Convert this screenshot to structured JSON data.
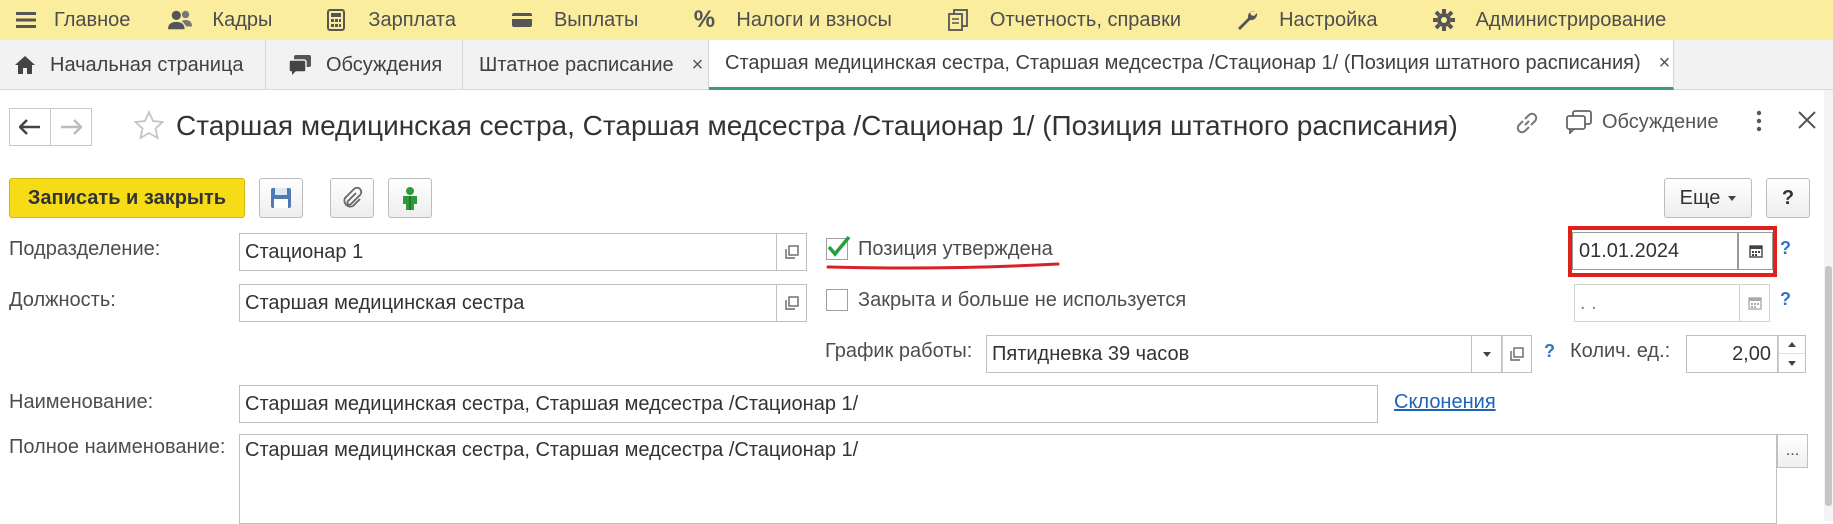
{
  "topbar": {
    "items": [
      {
        "label": "Главное",
        "icon": "home-icon"
      },
      {
        "label": "Кадры",
        "icon": "people-icon"
      },
      {
        "label": "Зарплата",
        "icon": "calculator-icon"
      },
      {
        "label": "Выплаты",
        "icon": "wallet-icon"
      },
      {
        "label": "Налоги и взносы",
        "icon": "percent-icon"
      },
      {
        "label": "Отчетность, справки",
        "icon": "documents-icon"
      },
      {
        "label": "Настройка",
        "icon": "wrench-icon"
      },
      {
        "label": "Администрирование",
        "icon": "gear-icon"
      }
    ]
  },
  "tabs": [
    {
      "label": "Начальная страница",
      "icon": "home-icon"
    },
    {
      "label": "Обсуждения",
      "icon": "chat-icon"
    },
    {
      "label": "Штатное расписание",
      "close": "×"
    },
    {
      "label": "Старшая медицинская сестра, Старшая медсестра /Стационар 1/ (Позиция штатного расписания)",
      "close": "×"
    }
  ],
  "header": {
    "title": "Старшая медицинская сестра, Старшая медсестра /Стационар 1/ (Позиция штатного расписания)",
    "discussion_label": "Обсуждение"
  },
  "toolbar": {
    "save_close_label": "Записать и закрыть",
    "more_label": "Еще",
    "help_label": "?"
  },
  "form": {
    "division_label": "Подразделение:",
    "division_value": "Стационар 1",
    "position_label": "Должность:",
    "position_value": "Старшая медицинская сестра",
    "approved_label": "Позиция утверждена",
    "approved_checked": true,
    "approved_date": "01.01.2024",
    "closed_label": "Закрыта и больше не используется",
    "closed_checked": false,
    "closed_date": " .  .",
    "schedule_label": "График работы:",
    "schedule_value": "Пятидневка 39 часов",
    "qty_label": "Колич. ед.:",
    "qty_value": "2,00",
    "name_label": "Наименование:",
    "name_value": "Старшая медицинская сестра, Старшая медсестра /Стационар 1/",
    "declensions_link": "Склонения",
    "fullname_label": "Полное наименование:",
    "fullname_value": "Старшая медицинская сестра, Старшая медсестра /Стационар 1/",
    "help_mark": "?",
    "ellipsis": "..."
  },
  "colors": {
    "topbar_bg": "#fbed9e",
    "primary_button": "#f5dc17",
    "active_tab_underline": "#3c9d6f",
    "highlight_box": "#e0201b",
    "underline_mark": "#d8202b",
    "check_mark": "#23a038",
    "link": "#1d63b7"
  }
}
